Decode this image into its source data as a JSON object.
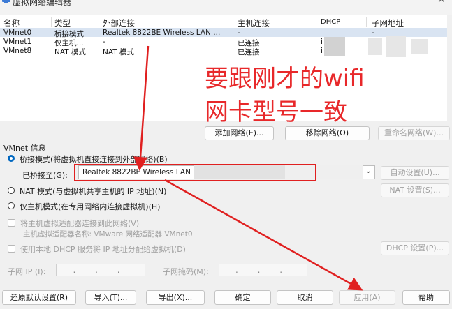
{
  "window": {
    "title": "虚拟网络编辑器",
    "close_glyph": "✕"
  },
  "table": {
    "headers": [
      "名称",
      "类型",
      "外部连接",
      "主机连接",
      "DHCP",
      "子网地址"
    ],
    "rows": [
      {
        "name": "VMnet0",
        "type": "桥接模式",
        "external": "Realtek 8822BE Wireless LAN ...",
        "host": "-",
        "dhcp": "",
        "subnet": "-"
      },
      {
        "name": "VMnet1",
        "type": "仅主机...",
        "external": "-",
        "host": "已连接",
        "dhcp": "i",
        "subnet": ""
      },
      {
        "name": "VMnet8",
        "type": "NAT 模式",
        "external": "NAT 模式",
        "host": "已连接",
        "dhcp": "i",
        "subnet": ""
      }
    ]
  },
  "network_buttons": {
    "add": "添加网络(E)...",
    "remove": "移除网络(O)",
    "rename": "重命名网络(W)..."
  },
  "vmnet_info": {
    "section_label": "VMnet 信息",
    "bridged": {
      "label": "桥接模式(将虚拟机直接连接到外部网络)(B)",
      "selected": true
    },
    "bridged_to_label": "已桥接至(G):",
    "bridged_to_value": "Realtek 8822BE Wireless LAN",
    "auto_settings": "自动设置(U)...",
    "nat": {
      "label": "NAT 模式(与虚拟机共享主机的 IP 地址)(N)",
      "selected": false
    },
    "nat_settings": "NAT 设置(S)...",
    "host_only": {
      "label": "仅主机模式(在专用网络内连接虚拟机)(H)",
      "selected": false
    },
    "connect_adapter": "将主机虚拟适配器连接到此网络(V)",
    "adapter_name": "主机虚拟适配器名称: VMware 网络适配器 VMnet0",
    "use_dhcp": "使用本地 DHCP 服务将 IP 地址分配给虚拟机(D)",
    "dhcp_settings": "DHCP 设置(P)...",
    "subnet_ip_label": "子网 IP (I):",
    "subnet_mask_label": "子网掩码(M):"
  },
  "footer_buttons": {
    "restore": "还原默认设置(R)",
    "import": "导入(T)...",
    "export": "导出(X)...",
    "ok": "确定",
    "cancel": "取消",
    "apply": "应用(A)",
    "help": "帮助"
  },
  "annotation": {
    "line1": "要跟刚才的wifi",
    "line2": "网卡型号一致",
    "color": "#e8282a"
  },
  "colors": {
    "accent": "#0067c0",
    "selection": "#d9e4f2",
    "annotation": "#e02020"
  }
}
